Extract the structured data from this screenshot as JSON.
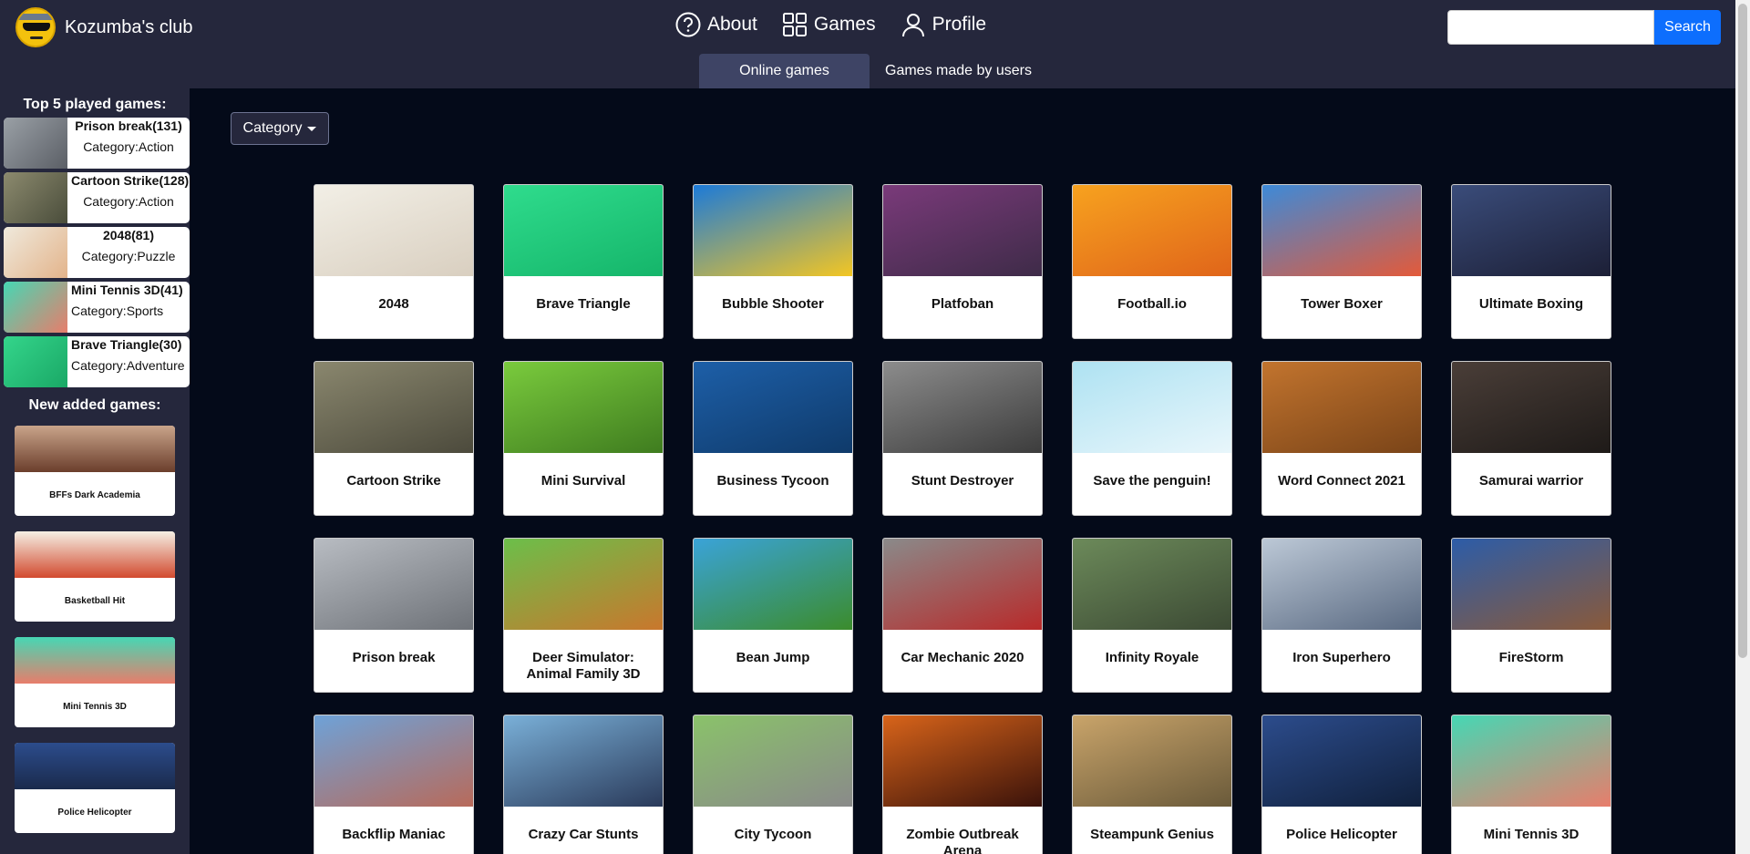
{
  "brand": {
    "name": "Kozumba's club"
  },
  "nav": {
    "about": "About",
    "games": "Games",
    "profile": "Profile"
  },
  "search": {
    "placeholder": "",
    "button": "Search"
  },
  "tabs": {
    "online": "Online games",
    "users": "Games made by users"
  },
  "sidebar": {
    "top_heading": "Top 5 played games:",
    "top_games": [
      {
        "name": "Prison break(131)",
        "category": "Category:Action",
        "colors": [
          "#9aa0a6",
          "#5b5f66"
        ]
      },
      {
        "name": "Cartoon Strike(128)",
        "category": "Category:Action",
        "colors": [
          "#8c8a6e",
          "#4a4d3b"
        ]
      },
      {
        "name": "2048(81)",
        "category": "Category:Puzzle",
        "colors": [
          "#efe9dc",
          "#e3b48b"
        ]
      },
      {
        "name": "Mini Tennis 3D(41)",
        "category": "Category:Sports",
        "colors": [
          "#46d7b4",
          "#e87d6b"
        ]
      },
      {
        "name": "Brave Triangle(30)",
        "category": "Category:Adventure",
        "colors": [
          "#34d58b",
          "#1aa866"
        ]
      }
    ],
    "new_heading": "New added games:",
    "new_games": [
      {
        "name": "BFFs Dark Academia",
        "colors": [
          "#c9a48a",
          "#6b3e2c"
        ]
      },
      {
        "name": "Basketball Hit",
        "colors": [
          "#f5efe4",
          "#d24a2f"
        ]
      },
      {
        "name": "Mini Tennis 3D",
        "colors": [
          "#46d7b4",
          "#e87d6b"
        ]
      },
      {
        "name": "Police Helicopter",
        "colors": [
          "#2c4c8c",
          "#1a2a4c"
        ]
      }
    ]
  },
  "category_button": "Category",
  "games": [
    {
      "title": "2048",
      "colors": [
        "#f2efe6",
        "#d9cfc0"
      ]
    },
    {
      "title": "Brave Triangle",
      "colors": [
        "#2fdc8d",
        "#15b56a"
      ]
    },
    {
      "title": "Bubble Shooter",
      "colors": [
        "#1c7ad8",
        "#f3c623"
      ]
    },
    {
      "title": "Platfoban",
      "colors": [
        "#7a3a7a",
        "#3e2b48"
      ]
    },
    {
      "title": "Football.io",
      "colors": [
        "#f7a21f",
        "#e0651a"
      ]
    },
    {
      "title": "Tower Boxer",
      "colors": [
        "#3d8ad8",
        "#e35a3a"
      ]
    },
    {
      "title": "Ultimate Boxing",
      "colors": [
        "#3a4c7a",
        "#1c1f36"
      ]
    },
    {
      "title": "Cartoon Strike",
      "colors": [
        "#8a876e",
        "#4c4a3c"
      ]
    },
    {
      "title": "Mini Survival",
      "colors": [
        "#7acb3d",
        "#3f7c1f"
      ]
    },
    {
      "title": "Business Tycoon",
      "colors": [
        "#1d5fa8",
        "#0f3a6a"
      ]
    },
    {
      "title": "Stunt Destroyer",
      "colors": [
        "#8c8c8c",
        "#3c3c3c"
      ]
    },
    {
      "title": "Save the penguin!",
      "colors": [
        "#aee2f2",
        "#e8f6fb"
      ]
    },
    {
      "title": "Word Connect 2021",
      "colors": [
        "#c2742e",
        "#7a4418"
      ]
    },
    {
      "title": "Samurai warrior",
      "colors": [
        "#4a3e38",
        "#1e1a18"
      ]
    },
    {
      "title": "Prison break",
      "colors": [
        "#b8bcc2",
        "#6e7278"
      ]
    },
    {
      "title": "Deer Simulator: Animal Family 3D",
      "colors": [
        "#6bbf4a",
        "#c9772d"
      ]
    },
    {
      "title": "Bean Jump",
      "colors": [
        "#3aa3d8",
        "#3b8c2c"
      ]
    },
    {
      "title": "Car Mechanic 2020",
      "colors": [
        "#8a8a8a",
        "#b82a2a"
      ]
    },
    {
      "title": "Infinity Royale",
      "colors": [
        "#6c8a5a",
        "#3c4a34"
      ]
    },
    {
      "title": "Iron Superhero",
      "colors": [
        "#bcc8d6",
        "#5a6a82"
      ]
    },
    {
      "title": "FireStorm",
      "colors": [
        "#2c5ca8",
        "#8a5a3a"
      ]
    },
    {
      "title": "Backflip Maniac",
      "colors": [
        "#6ea2d8",
        "#b86a5a"
      ]
    },
    {
      "title": "Crazy Car Stunts",
      "colors": [
        "#7ab0d8",
        "#2a3a5a"
      ]
    },
    {
      "title": "City Tycoon",
      "colors": [
        "#8ac26a",
        "#8a8a8a"
      ]
    },
    {
      "title": "Zombie Outbreak Arena",
      "colors": [
        "#d8641a",
        "#3a120a"
      ]
    },
    {
      "title": "Steampunk Genius",
      "colors": [
        "#c9a46a",
        "#6a5a3a"
      ]
    },
    {
      "title": "Police Helicopter",
      "colors": [
        "#2c4c8c",
        "#10203c"
      ]
    },
    {
      "title": "Mini Tennis 3D",
      "colors": [
        "#46d7b4",
        "#e87d6b"
      ]
    }
  ]
}
